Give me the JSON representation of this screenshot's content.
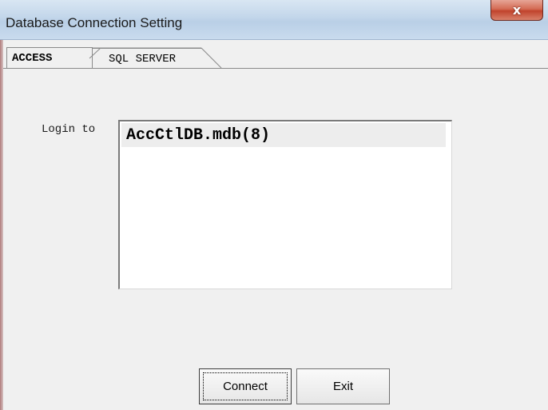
{
  "window": {
    "title": "Database Connection Setting",
    "close_icon": "close-icon",
    "close_glyph": "x"
  },
  "tabs": [
    {
      "label": "ACCESS",
      "selected": true
    },
    {
      "label": "SQL SERVER",
      "selected": false
    }
  ],
  "access": {
    "login_label": "Login to",
    "databases": [
      "AccCtlDB.mdb(8)"
    ]
  },
  "buttons": {
    "connect_label": "Connect",
    "exit_label": "Exit"
  }
}
